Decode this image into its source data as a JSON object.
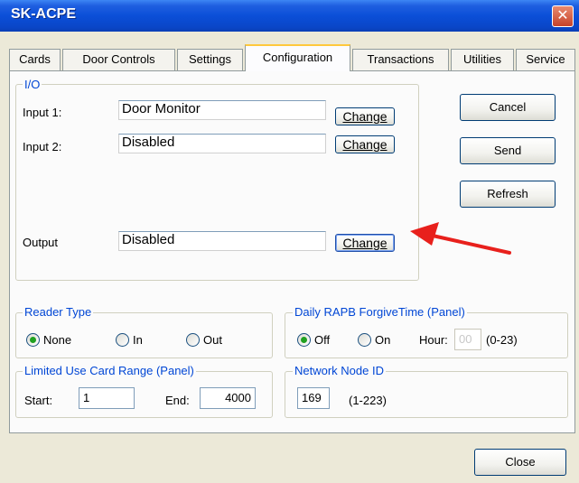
{
  "window": {
    "title": "SK-ACPE",
    "close_glyph": "✕"
  },
  "tabs": [
    {
      "label": "Cards"
    },
    {
      "label": "Door Controls"
    },
    {
      "label": "Settings"
    },
    {
      "label": "Configuration",
      "active": true
    },
    {
      "label": "Transactions"
    },
    {
      "label": "Utilities"
    },
    {
      "label": "Service"
    }
  ],
  "io": {
    "legend": "I/O",
    "input1": {
      "label": "Input 1:",
      "value": "Door Monitor",
      "button": "Change"
    },
    "input2": {
      "label": "Input 2:",
      "value": "Disabled",
      "button": "Change"
    },
    "output": {
      "label": "Output",
      "value": "Disabled",
      "button": "Change"
    }
  },
  "side_buttons": {
    "cancel": "Cancel",
    "send": "Send",
    "refresh": "Refresh"
  },
  "reader_type": {
    "legend": "Reader Type",
    "options": [
      {
        "label": "None",
        "checked": true
      },
      {
        "label": "In",
        "checked": false
      },
      {
        "label": "Out",
        "checked": false
      }
    ]
  },
  "rapb": {
    "legend": "Daily RAPB ForgiveTime (Panel)",
    "options": [
      {
        "label": "Off",
        "checked": true
      },
      {
        "label": "On",
        "checked": false
      }
    ],
    "hour_label": "Hour:",
    "hour_value": "00",
    "range": "(0-23)"
  },
  "card_range": {
    "legend": "Limited Use Card Range (Panel)",
    "start_label": "Start:",
    "start_value": "1",
    "end_label": "End:",
    "end_value": "4000"
  },
  "node": {
    "legend": "Network Node ID",
    "value": "169",
    "range": "(1-223)"
  },
  "footer": {
    "close": "Close"
  },
  "colors": {
    "title_bar": "#0b4fd8",
    "legend_text": "#0046d5",
    "arrow": "#e8201c",
    "radio_dot": "#21a121"
  }
}
